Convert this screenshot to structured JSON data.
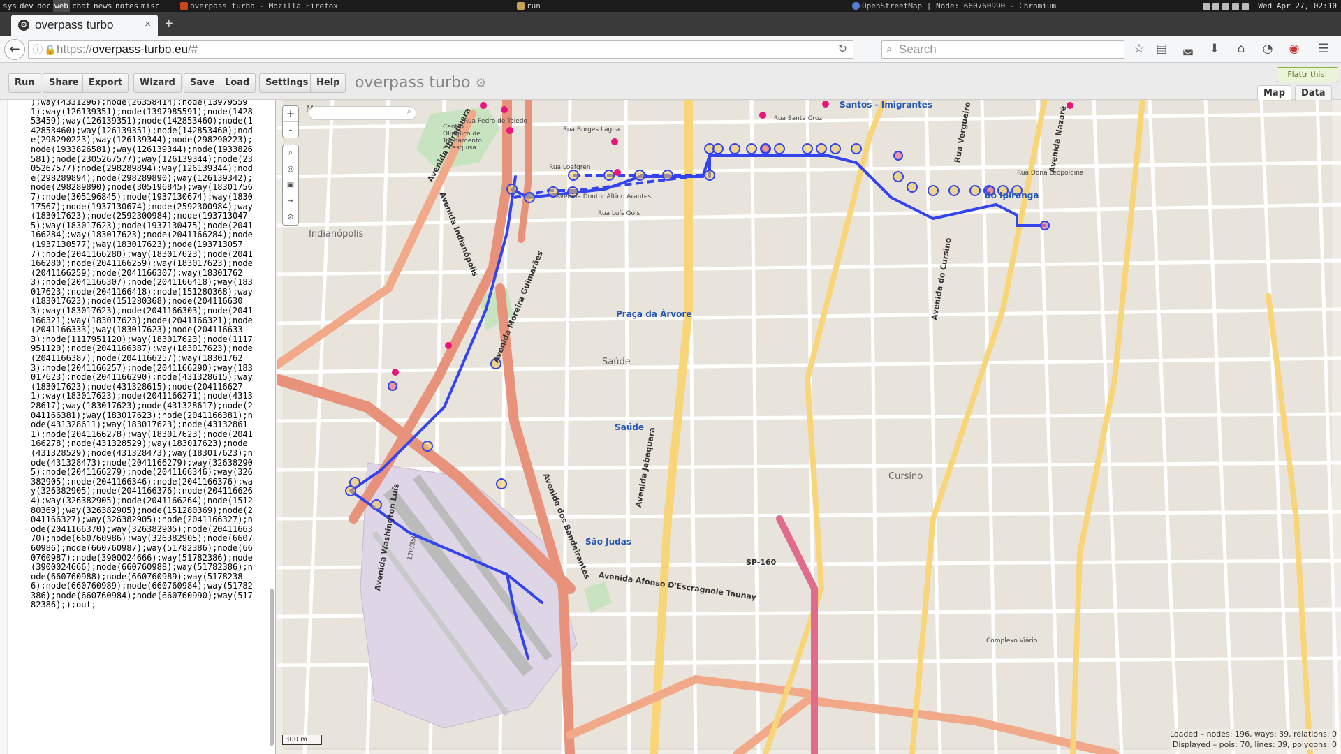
{
  "desktop": {
    "workspaces": [
      "sys",
      "dev",
      "doc",
      "web",
      "chat",
      "news",
      "notes",
      "misc"
    ],
    "active_workspace": "web",
    "windows": [
      {
        "title": "overpass turbo - Mozilla Firefox",
        "icon_color": "#c8441a"
      },
      {
        "title": "run",
        "icon_color": "#caa25c"
      },
      {
        "title": "OpenStreetMap | Node: 660760990 - Chromium",
        "icon_color": "#4f7fd1"
      }
    ],
    "clock": "Wed Apr 27, 02:10"
  },
  "browser": {
    "tab_title": "overpass turbo",
    "tab_close": "×",
    "new_tab": "+",
    "url_scheme": "https://",
    "url_host": "overpass-turbo.eu",
    "url_path": "/#",
    "search_placeholder": "Search",
    "icons": [
      "star-icon",
      "bookmark-list-icon",
      "pocket-icon",
      "download-icon",
      "home-icon",
      "chat-icon",
      "addon-icon",
      "menu-icon"
    ]
  },
  "toolbar": {
    "buttons": [
      "Run",
      "Share",
      "Export",
      "Wizard",
      "Save",
      "Load",
      "Settings",
      "Help"
    ],
    "app_title": "overpass turbo",
    "flattr": "Flattr this!",
    "view_tabs": [
      "Map",
      "Data"
    ],
    "active_view": "Map"
  },
  "editor": {
    "code": ");way(4331296);node(26358414);node(139795591);way(126139351);node(1397985591);node(142853459);way(126139351);node(142853460);node(142853460);way(126139351);node(142853460);node(298290223);way(126139344);node(298290223);node(1933826581);way(126139344);node(1933826581);node(2305267577);way(126139344);node(2305267577);node(298289894);way(126139344);node(298289894);node(298289890);way(126139342);node(298289890);node(305196845);way(183017567);node(305196845);node(1937130674);way(183017567);node(1937130674);node(2592300984);way(183017623);node(2592300984);node(1937130475);way(183017623);node(1937130475);node(2041166284);way(183017623);node(2041166284);node(1937130577);way(183017623);node(1937130577);node(2041166280);way(183017623);node(2041166280);node(2041166259);way(183017623);node(2041166259);node(2041166307);way(183017623);node(2041166307);node(2041166418);way(183017623);node(2041166418);node(151280368);way(183017623);node(151280368);node(2041166303);way(183017623);node(2041166303);node(2041166321);way(183017623);node(2041166321);node(2041166333);way(183017623);node(2041166333);node(1117951120);way(183017623);node(1117951120);node(2041166387);way(183017623);node(2041166387);node(2041166257);way(183017623);node(2041166257);node(2041166290);way(183017623);node(2041166290);node(431328615);way(183017623);node(431328615);node(2041166271);way(183017623);node(2041166271);node(431328617);way(183017623);node(431328617);node(2041166381);way(183017623);node(2041166381);node(431328611);way(183017623);node(431328611);node(2041166278);way(183017623);node(2041166278);node(431328529);way(183017623);node(431328529);node(431328473);way(183017623);node(431328473);node(2041166279);way(326382905);node(2041166279);node(2041166346);way(326382905);node(2041166346);node(2041166376);way(326382905);node(2041166376);node(2041166264);way(326382905);node(2041166264);node(151280369);way(326382905);node(151280369);node(2041166327);way(326382905);node(2041166327);node(2041166370);way(326382905);node(2041166370);node(660760986);way(326382905);node(660760986);node(660760987);way(51782386);node(660760987);node(3900024666);way(51782386);node(3900024666);node(660760988);way(51782386);node(660760988);node(660760989);way(51782386);node(660760989);node(660760984);way(51782386);node(660760984);node(660760990);way(51782386););out;"
  },
  "map": {
    "zoom_in": "+",
    "zoom_out": "-",
    "tool_icons": [
      "search-icon",
      "locate-icon",
      "data-icon",
      "fit-icon",
      "clear-icon"
    ],
    "scale": "300 m",
    "status_loaded": "Loaded – nodes: 196, ways: 39, relations: 0",
    "status_displayed": "Displayed – pois: 70, lines: 39, polygons: 0",
    "labels": {
      "moema": "Moema",
      "indianopolis": "Indianópolis",
      "saude": "Saúde",
      "cursino": "Cursino",
      "santos_imigrantes": "Santos - Imigrantes",
      "do_ipiranga": "do Ipiranga",
      "praca_da_arvore": "Praça da Árvore",
      "saude_station": "Saúde",
      "sao_judas": "São Judas",
      "av_ibirapuera": "Avenida Ibirapuera",
      "av_indianopolis": "Avenida Indianópolis",
      "av_moreira_guimaraes": "Avenida Moreira Guimarães",
      "av_jabaquara": "Avenida Jabaquara",
      "av_dos_bandeirantes": "Avenida dos Bandeirantes",
      "av_washington_luis": "Avenida Washington Luís",
      "av_afonso": "Avenida Afonso D'Escragnole Taunay",
      "av_doutor_altino": "Avenida Doutor Altino Arantes",
      "rua_loefgren": "Rua Loefgren",
      "rua_luis_gois": "Rua Luís Góis",
      "rua_borges_lagoa": "Rua Borges Lagoa",
      "rua_pedro_toledo": "Rua Pedro de Toledo",
      "centro_olimpico": "Centro Olímpico de Treinamento e Pesquisa",
      "sp160": "SP-160",
      "complexo": "Complexo Viário",
      "rua_santa_cruz": "Rua Santa Cruz",
      "rua_dona_leopoldina": "Rua Dona Leopoldina",
      "av_do_cursino": "Avenida do Cursino",
      "rua_vergueiro": "Rua Vergueiro",
      "av_nazare": "Avenida Nazaré",
      "runway": "17R/35L"
    }
  }
}
